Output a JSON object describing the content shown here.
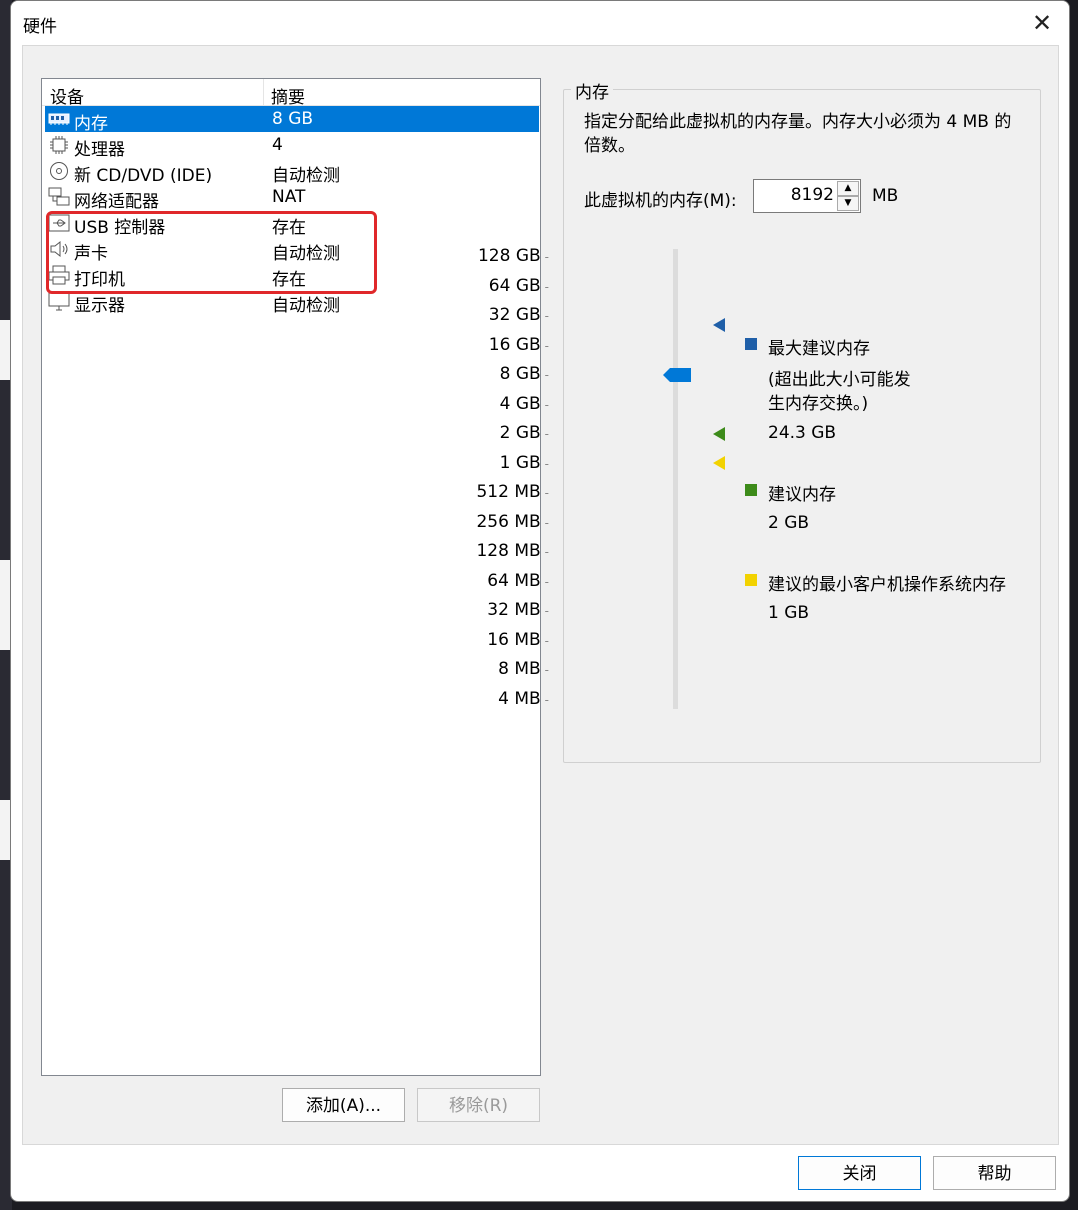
{
  "dialog": {
    "title": "硬件",
    "close_icon": "close-icon"
  },
  "device_list": {
    "headers": [
      "设备",
      "摘要"
    ],
    "rows": [
      {
        "name": "内存",
        "summary": "8 GB",
        "icon": "memory-icon",
        "selected": true
      },
      {
        "name": "处理器",
        "summary": "4",
        "icon": "cpu-icon"
      },
      {
        "name": "新 CD/DVD (IDE)",
        "summary": "自动检测",
        "icon": "cd-icon"
      },
      {
        "name": "网络适配器",
        "summary": "NAT",
        "icon": "network-icon"
      },
      {
        "name": "USB 控制器",
        "summary": "存在",
        "icon": "usb-icon"
      },
      {
        "name": "声卡",
        "summary": "自动检测",
        "icon": "speaker-icon"
      },
      {
        "name": "打印机",
        "summary": "存在",
        "icon": "printer-icon"
      },
      {
        "name": "显示器",
        "summary": "自动检测",
        "icon": "monitor-icon"
      }
    ],
    "add_label": "添加(A)...",
    "remove_label": "移除(R)"
  },
  "memory": {
    "group_title": "内存",
    "description": "指定分配给此虚拟机的内存量。内存大小必须为 4 MB 的倍数。",
    "field_label": "此虚拟机的内存(M):",
    "value": "8192",
    "unit": "MB",
    "scale": [
      "128 GB",
      "64 GB",
      "32 GB",
      "16 GB",
      "8 GB",
      "4 GB",
      "2 GB",
      "1 GB",
      "512 MB",
      "256 MB",
      "128 MB",
      "64 MB",
      "32 MB",
      "16 MB",
      "8 MB",
      "4 MB"
    ],
    "current_level": "8 GB",
    "legend": {
      "max_title": "最大建议内存",
      "max_note": "(超出此大小可能发生内存交换。)",
      "max_value": "24.3 GB",
      "rec_title": "建议内存",
      "rec_value": "2 GB",
      "min_title": "建议的最小客户机操作系统内存",
      "min_value": "1 GB"
    },
    "colors": {
      "max": "#1f5fa8",
      "rec": "#3d8b1a",
      "min": "#f2d200",
      "thumb": "#0078d7"
    }
  },
  "footer": {
    "close_label": "关闭",
    "help_label": "帮助"
  }
}
